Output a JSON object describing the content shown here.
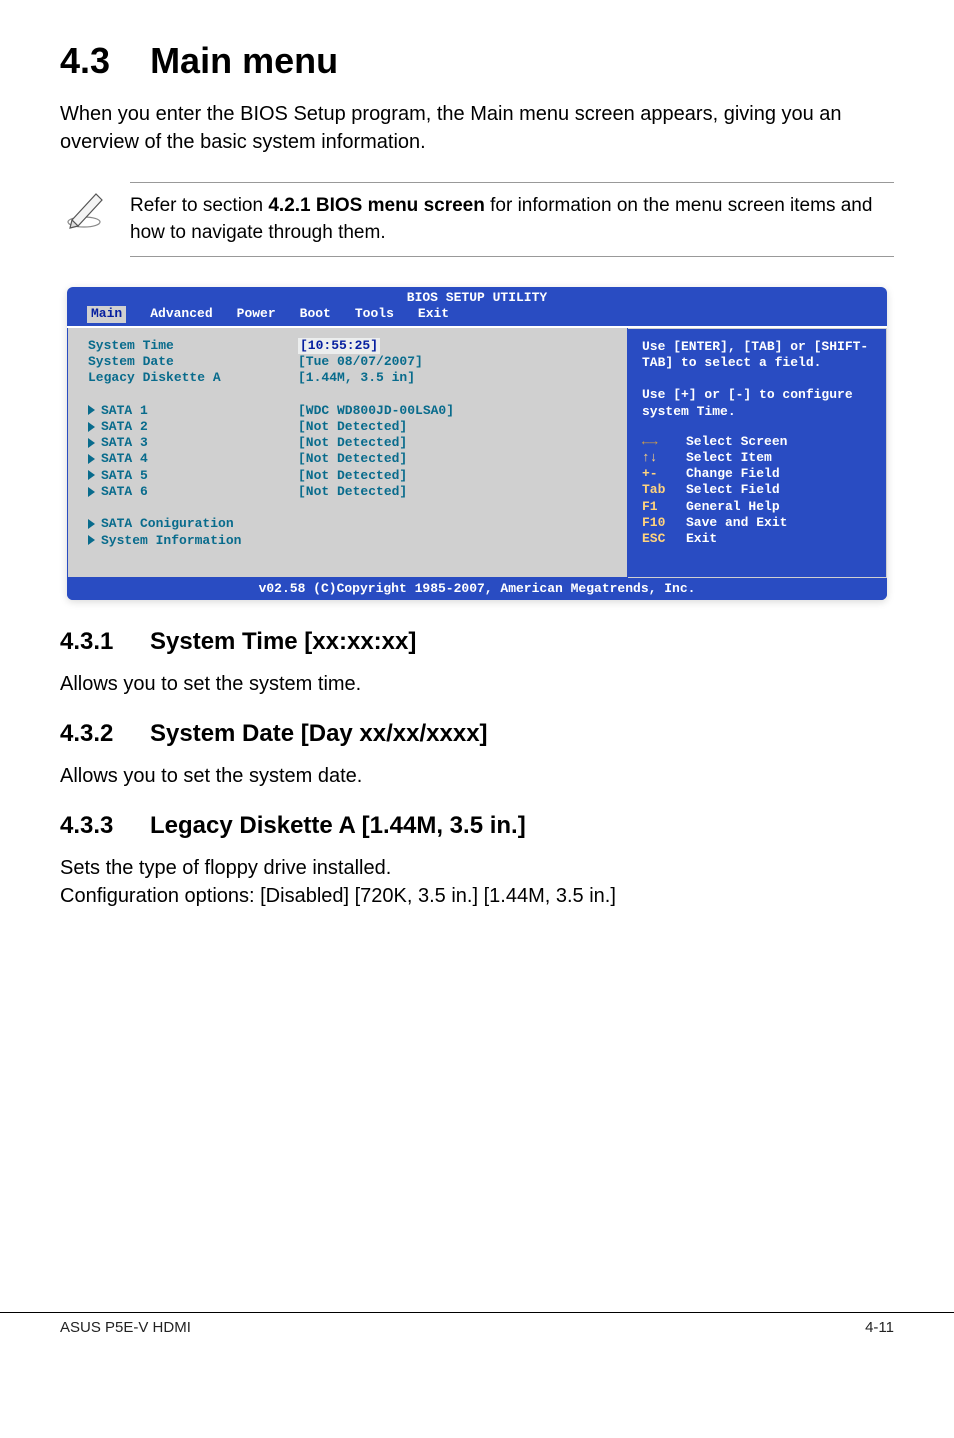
{
  "section": {
    "num": "4.3",
    "title": "Main menu",
    "intro": "When you enter the BIOS Setup program, the Main menu screen appears, giving you an overview of the basic system information."
  },
  "note": {
    "pre": "Refer to section ",
    "bold": "4.2.1  BIOS menu screen",
    "post": " for information on the menu screen items and how to navigate through them."
  },
  "bios": {
    "util_title": "BIOS SETUP UTILITY",
    "tabs": [
      "Main",
      "Advanced",
      "Power",
      "Boot",
      "Tools",
      "Exit"
    ],
    "rows_top": [
      {
        "label": "System Time",
        "value": "[10:55:25]",
        "time": true
      },
      {
        "label": "System Date",
        "value": "[Tue 08/07/2007]"
      },
      {
        "label": "Legacy Diskette A",
        "value": "[1.44M, 3.5 in]"
      }
    ],
    "rows_sata": [
      {
        "label": "SATA 1",
        "value": "[WDC WD800JD-00LSA0]"
      },
      {
        "label": "SATA 2",
        "value": "[Not Detected]"
      },
      {
        "label": "SATA 3",
        "value": "[Not Detected]"
      },
      {
        "label": "SATA 4",
        "value": "[Not Detected]"
      },
      {
        "label": "SATA 5",
        "value": "[Not Detected]"
      },
      {
        "label": "SATA 6",
        "value": "[Not Detected]"
      }
    ],
    "rows_bottom": [
      {
        "label": "SATA Coniguration"
      },
      {
        "label": "System Information"
      }
    ],
    "help_top": "Use [ENTER], [TAB] or [SHIFT-TAB] to select a field.\n\nUse [+] or [-] to configure system Time.",
    "help_keys": [
      {
        "arrow_lr": true,
        "desc": "Select Screen"
      },
      {
        "arrow_ud": true,
        "desc": "Select Item"
      },
      {
        "key": "+-",
        "desc": "Change Field"
      },
      {
        "key": "Tab",
        "desc": "Select Field"
      },
      {
        "key": "F1",
        "desc": "General Help"
      },
      {
        "key": "F10",
        "desc": "Save and Exit"
      },
      {
        "key": "ESC",
        "desc": "Exit"
      }
    ],
    "footer": "v02.58 (C)Copyright 1985-2007, American Megatrends, Inc."
  },
  "subs": [
    {
      "num": "4.3.1",
      "title": "System Time [xx:xx:xx]",
      "text": "Allows you to set the system time."
    },
    {
      "num": "4.3.2",
      "title": "System Date [Day xx/xx/xxxx]",
      "text": "Allows you to set the system date."
    },
    {
      "num": "4.3.3",
      "title": "Legacy Diskette A [1.44M, 3.5 in.]",
      "text": "Sets the type of floppy drive installed.\nConfiguration options: [Disabled] [720K, 3.5 in.] [1.44M, 3.5 in.]"
    }
  ],
  "footer": {
    "left": "ASUS P5E-V HDMI",
    "right": "4-11"
  }
}
